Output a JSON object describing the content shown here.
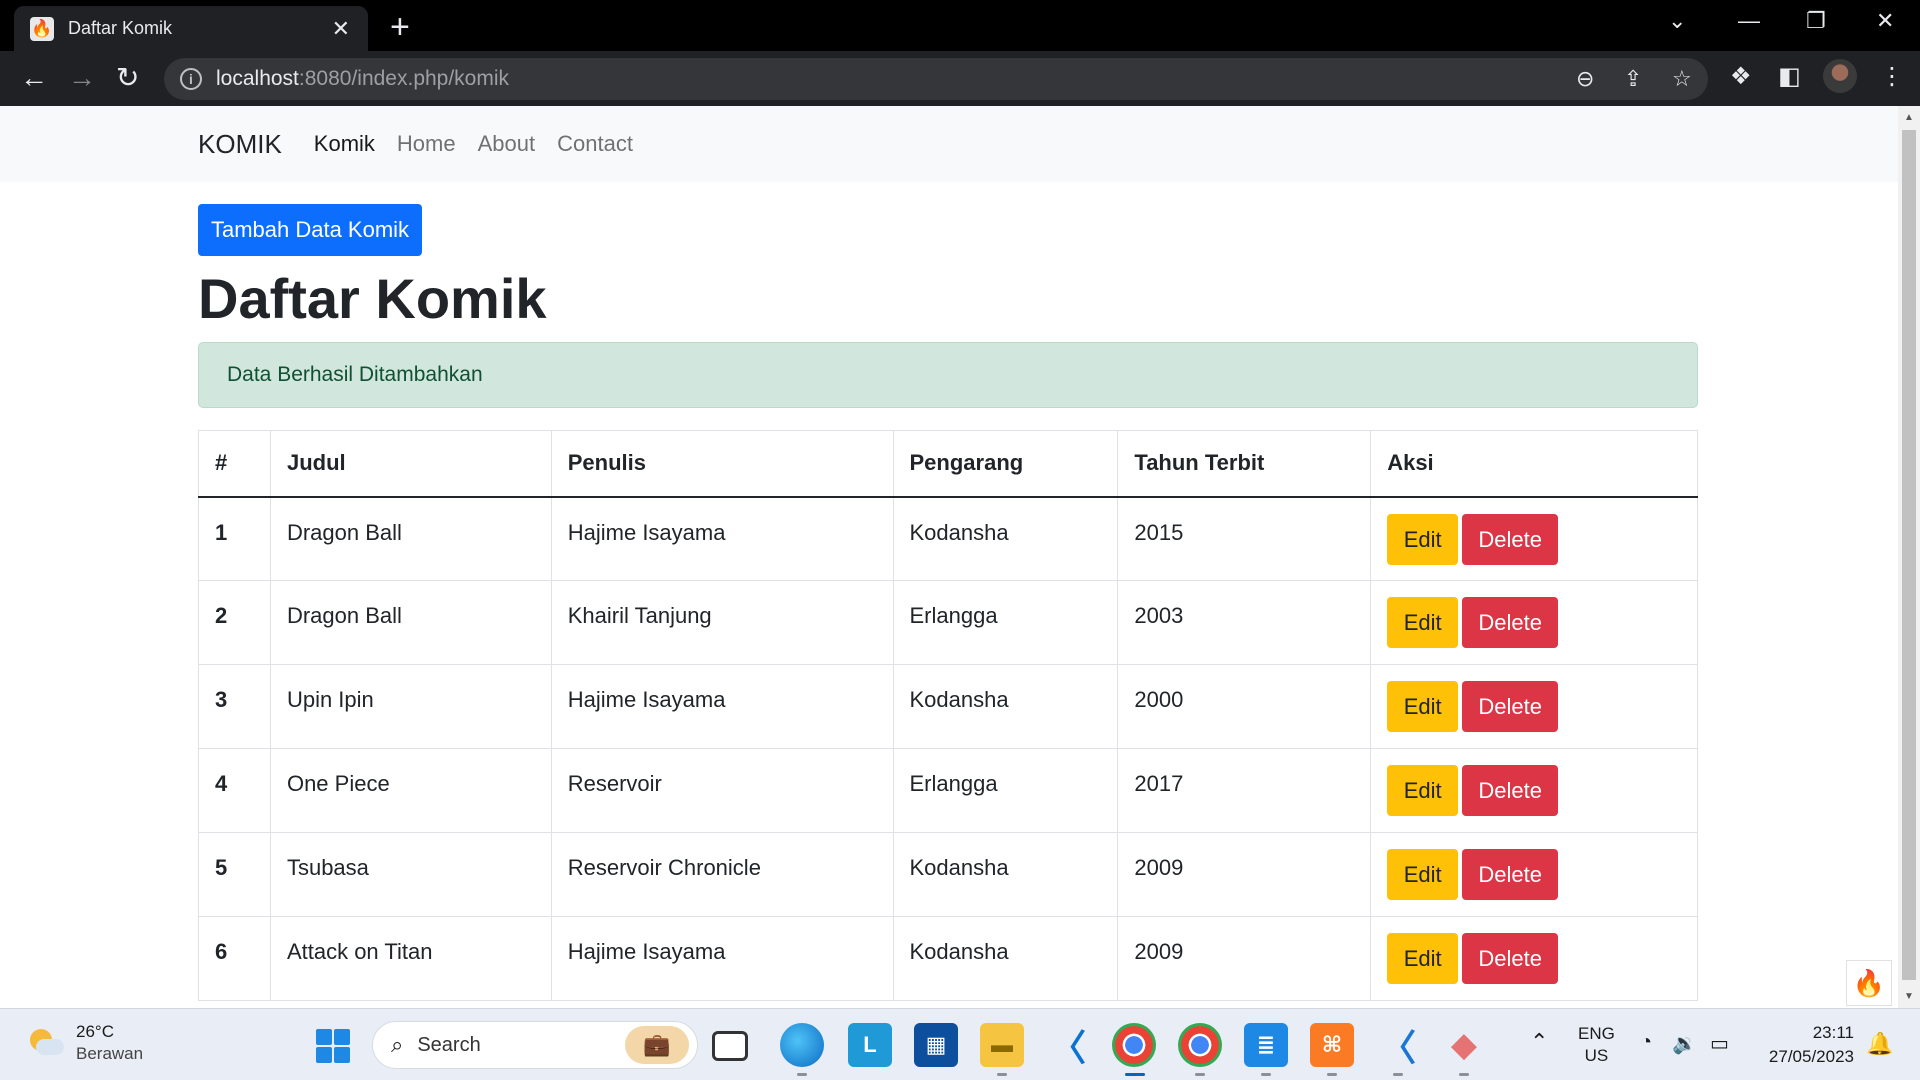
{
  "browser": {
    "tab_title": "Daftar Komik",
    "tab_close": "✕",
    "new_tab": "+",
    "url_host": "localhost",
    "url_path": ":8080/index.php/komik"
  },
  "navbar": {
    "brand": "KOMIK",
    "links": [
      "Komik",
      "Home",
      "About",
      "Contact"
    ]
  },
  "page": {
    "add_button": "Tambah Data Komik",
    "heading": "Daftar Komik",
    "alert": "Data Berhasil Ditambahkan"
  },
  "table": {
    "headers": [
      "#",
      "Judul",
      "Penulis",
      "Pengarang",
      "Tahun Terbit",
      "Aksi"
    ],
    "rows": [
      {
        "num": "1",
        "judul": "Dragon Ball",
        "penulis": "Hajime Isayama",
        "pengarang": "Kodansha",
        "tahun": "2015"
      },
      {
        "num": "2",
        "judul": "Dragon Ball",
        "penulis": "Khairil Tanjung",
        "pengarang": "Erlangga",
        "tahun": "2003"
      },
      {
        "num": "3",
        "judul": "Upin Ipin",
        "penulis": "Hajime Isayama",
        "pengarang": "Kodansha",
        "tahun": "2000"
      },
      {
        "num": "4",
        "judul": "One Piece",
        "penulis": "Reservoir",
        "pengarang": "Erlangga",
        "tahun": "2017"
      },
      {
        "num": "5",
        "judul": "Tsubasa",
        "penulis": "Reservoir Chronicle",
        "pengarang": "Kodansha",
        "tahun": "2009"
      },
      {
        "num": "6",
        "judul": "Attack on Titan",
        "penulis": "Hajime Isayama",
        "pengarang": "Kodansha",
        "tahun": "2009"
      }
    ],
    "edit_label": "Edit",
    "delete_label": "Delete"
  },
  "taskbar": {
    "weather_temp": "26°C",
    "weather_desc": "Berawan",
    "search_label": "Search",
    "lang_top": "ENG",
    "lang_bottom": "US",
    "time": "23:11",
    "date": "27/05/2023"
  },
  "colors": {
    "primary": "#0d6efd",
    "warning": "#ffc107",
    "danger": "#dc3545",
    "alert_bg": "#d1e7dd",
    "alert_text": "#0f5132"
  }
}
